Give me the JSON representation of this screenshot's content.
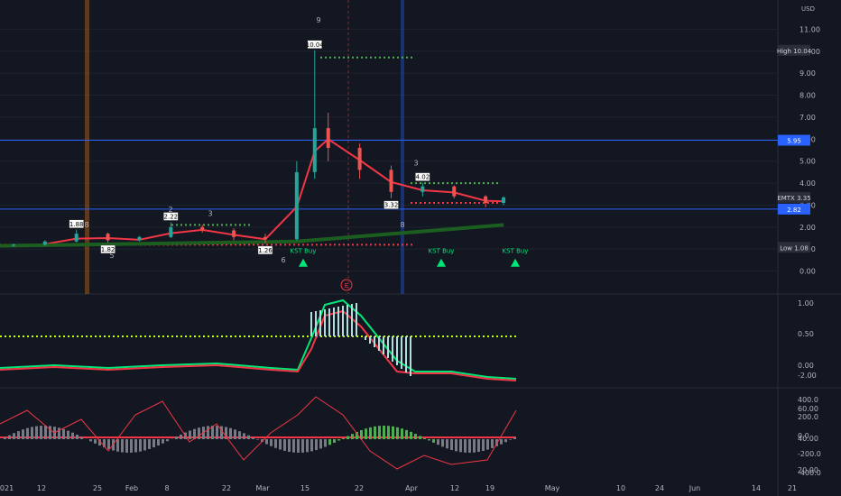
{
  "chart_data": {
    "type": "candlestick",
    "currency": "USD",
    "symbol": "EMTX",
    "price_axis": {
      "ticks": [
        0.0,
        1.0,
        2.0,
        3.0,
        4.0,
        5.0,
        6.0,
        7.0,
        8.0,
        9.0,
        10.0,
        11.0
      ],
      "ylim": [
        -1.0,
        12.0
      ]
    },
    "time_axis": {
      "labels": [
        "2021",
        "12",
        "25",
        "Feb",
        "8",
        "22",
        "Mar",
        "15",
        "22",
        "Apr",
        "12",
        "19",
        "May",
        "10",
        "24",
        "Jun",
        "14",
        "21"
      ],
      "range_start": "2021-01-01",
      "range_end": "2021-06-23"
    },
    "markers": {
      "high": {
        "label": "High",
        "value": "10.04"
      },
      "current": {
        "label": "EMTX",
        "value": "3.35"
      },
      "level1": {
        "value": "5.95"
      },
      "level2": {
        "value": "2.82"
      },
      "low": {
        "label": "Low",
        "value": "1.08"
      }
    },
    "annotations": {
      "kst_buy": [
        "KST Buy",
        "KST Buy",
        "KST Buy"
      ],
      "price_tags": [
        "10.04",
        "1.88",
        "1.82",
        "2.22",
        "1.26",
        "3.32",
        "4.02"
      ],
      "counts": [
        "8",
        "2",
        "3",
        "5",
        "6",
        "9",
        "3",
        "8"
      ],
      "earnings": "E"
    },
    "candles": [
      {
        "date": "2021-01-04",
        "o": 1.18,
        "h": 1.25,
        "l": 1.1,
        "c": 1.2
      },
      {
        "date": "2021-01-11",
        "o": 1.2,
        "h": 1.4,
        "l": 1.15,
        "c": 1.35
      },
      {
        "date": "2021-01-18",
        "o": 1.35,
        "h": 1.88,
        "l": 1.3,
        "c": 1.7
      },
      {
        "date": "2021-01-25",
        "o": 1.7,
        "h": 1.75,
        "l": 1.3,
        "c": 1.4
      },
      {
        "date": "2021-02-01",
        "o": 1.4,
        "h": 1.6,
        "l": 1.35,
        "c": 1.55
      },
      {
        "date": "2021-02-08",
        "o": 1.55,
        "h": 2.22,
        "l": 1.5,
        "c": 2.0
      },
      {
        "date": "2021-02-15",
        "o": 2.0,
        "h": 2.1,
        "l": 1.75,
        "c": 1.85
      },
      {
        "date": "2021-02-22",
        "o": 1.85,
        "h": 1.95,
        "l": 1.4,
        "c": 1.55
      },
      {
        "date": "2021-03-01",
        "o": 1.55,
        "h": 1.7,
        "l": 1.26,
        "c": 1.45
      },
      {
        "date": "2021-03-08",
        "o": 1.45,
        "h": 5.0,
        "l": 1.4,
        "c": 4.5
      },
      {
        "date": "2021-03-12",
        "o": 4.5,
        "h": 10.04,
        "l": 4.2,
        "c": 6.5
      },
      {
        "date": "2021-03-15",
        "o": 6.5,
        "h": 7.2,
        "l": 5.0,
        "c": 5.6
      },
      {
        "date": "2021-03-22",
        "o": 5.6,
        "h": 5.8,
        "l": 4.2,
        "c": 4.6
      },
      {
        "date": "2021-03-29",
        "o": 4.6,
        "h": 4.8,
        "l": 3.32,
        "c": 3.6
      },
      {
        "date": "2021-04-05",
        "o": 3.6,
        "h": 4.02,
        "l": 3.4,
        "c": 3.85
      },
      {
        "date": "2021-04-12",
        "o": 3.85,
        "h": 3.9,
        "l": 3.3,
        "c": 3.4
      },
      {
        "date": "2021-04-19",
        "o": 3.4,
        "h": 3.45,
        "l": 2.9,
        "c": 3.1
      },
      {
        "date": "2021-04-23",
        "o": 3.1,
        "h": 3.4,
        "l": 3.0,
        "c": 3.35
      }
    ],
    "panel2_ticks": [
      "1.00",
      "0.50",
      "0.00",
      "-2.00",
      "2.00",
      "1.00",
      "0.00"
    ],
    "panel3_ticks": [
      "400.0",
      "200.0",
      "0.0",
      "-200.0",
      "-400.0",
      "60.00",
      "40.00",
      "20.00"
    ]
  }
}
